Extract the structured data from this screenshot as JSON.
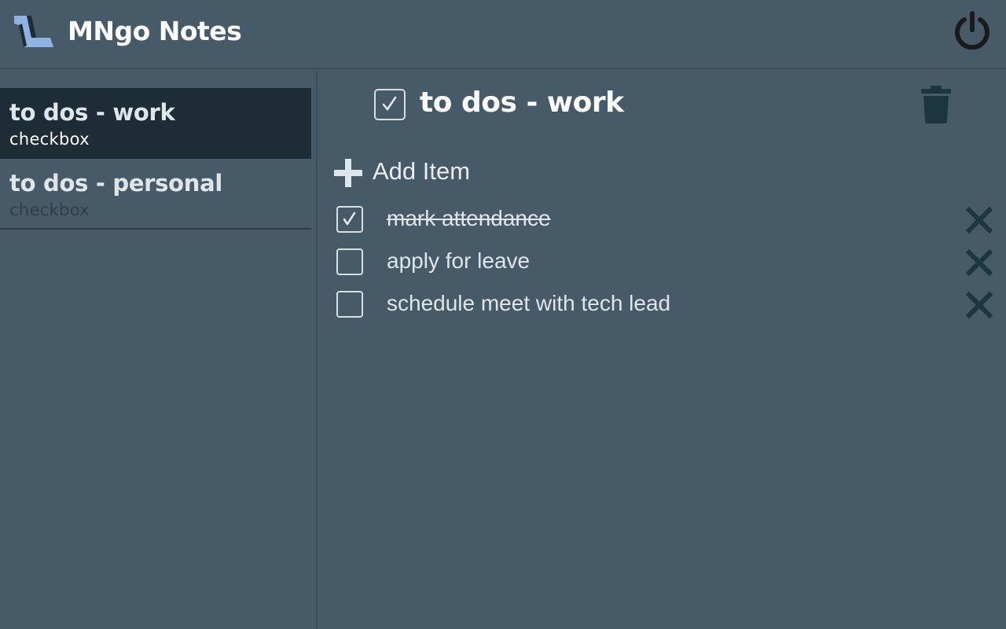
{
  "app": {
    "title": "MNgo Notes",
    "logo_icon": "logo-icon",
    "power_icon": "power-icon"
  },
  "colors": {
    "background": "#475a67",
    "sidebar_active": "#1e2c36",
    "icon_dark": "#1b3641",
    "logo_blue": "#8fb2e3"
  },
  "sidebar": {
    "items": [
      {
        "title": "to dos - work",
        "type": "checkbox",
        "active": true
      },
      {
        "title": "to dos - personal",
        "type": "checkbox",
        "active": false
      }
    ]
  },
  "note": {
    "title": "to dos - work",
    "checked": true,
    "delete_icon": "trash-icon",
    "add_label": "Add Item",
    "items": [
      {
        "text": "mark attendance",
        "done": true
      },
      {
        "text": "apply for leave",
        "done": false
      },
      {
        "text": "schedule meet with tech lead",
        "done": false
      }
    ]
  }
}
